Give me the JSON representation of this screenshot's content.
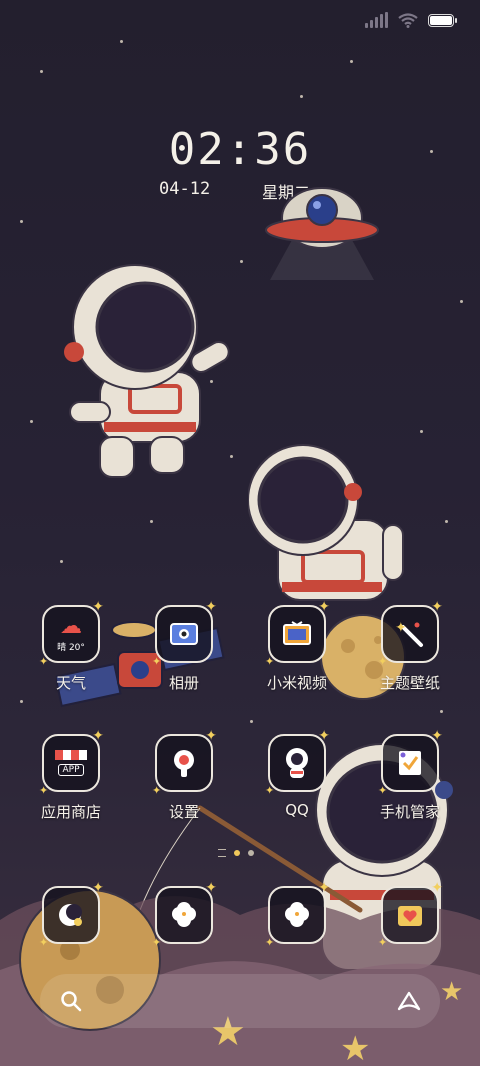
{
  "status_bar": {
    "battery_level": 1.0,
    "icons": [
      "signal-icon",
      "wifi-icon",
      "battery-icon"
    ]
  },
  "clock": {
    "time": "02:36",
    "date": "04-12",
    "weekday": "星期二"
  },
  "apps_row1": [
    {
      "label": "天气",
      "icon": "weather-icon",
      "mini_text": "晴 20°"
    },
    {
      "label": "相册",
      "icon": "gallery-icon"
    },
    {
      "label": "小米视频",
      "icon": "video-icon"
    },
    {
      "label": "主题壁纸",
      "icon": "themes-icon"
    }
  ],
  "apps_row2": [
    {
      "label": "应用商店",
      "icon": "app-store-icon",
      "mini_text": "APP"
    },
    {
      "label": "设置",
      "icon": "settings-icon"
    },
    {
      "label": "QQ",
      "icon": "qq-icon"
    },
    {
      "label": "手机管家",
      "icon": "security-icon"
    }
  ],
  "apps_row3": [
    {
      "label": "",
      "icon": "app-icon-1"
    },
    {
      "label": "",
      "icon": "app-icon-2"
    },
    {
      "label": "",
      "icon": "app-icon-3"
    },
    {
      "label": "",
      "icon": "app-icon-4"
    }
  ],
  "pager": {
    "current_page": 1,
    "pages": 2
  },
  "dock": {
    "left_icon": "search-icon",
    "right_icon": "assistant-icon"
  },
  "colors": {
    "background": "#231f2e",
    "accent_yellow": "#f2cf5e",
    "tile_border": "#ece7de"
  }
}
